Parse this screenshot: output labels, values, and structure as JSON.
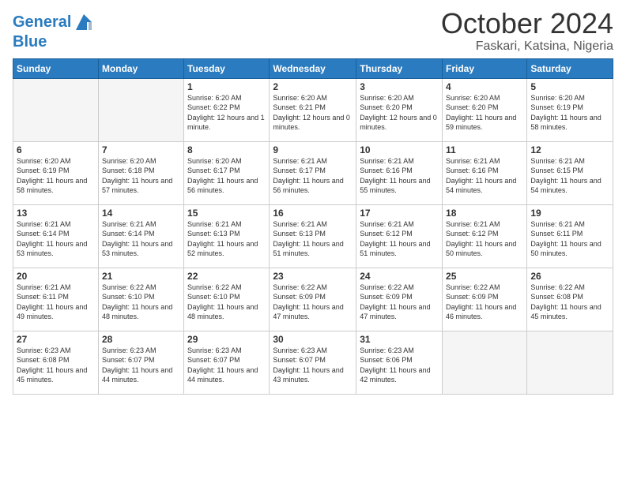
{
  "header": {
    "logo_line1": "General",
    "logo_line2": "Blue",
    "month": "October 2024",
    "location": "Faskari, Katsina, Nigeria"
  },
  "days_of_week": [
    "Sunday",
    "Monday",
    "Tuesday",
    "Wednesday",
    "Thursday",
    "Friday",
    "Saturday"
  ],
  "weeks": [
    [
      {
        "day": "",
        "info": ""
      },
      {
        "day": "",
        "info": ""
      },
      {
        "day": "1",
        "sunrise": "Sunrise: 6:20 AM",
        "sunset": "Sunset: 6:22 PM",
        "daylight": "Daylight: 12 hours and 1 minute."
      },
      {
        "day": "2",
        "sunrise": "Sunrise: 6:20 AM",
        "sunset": "Sunset: 6:21 PM",
        "daylight": "Daylight: 12 hours and 0 minutes."
      },
      {
        "day": "3",
        "sunrise": "Sunrise: 6:20 AM",
        "sunset": "Sunset: 6:20 PM",
        "daylight": "Daylight: 12 hours and 0 minutes."
      },
      {
        "day": "4",
        "sunrise": "Sunrise: 6:20 AM",
        "sunset": "Sunset: 6:20 PM",
        "daylight": "Daylight: 11 hours and 59 minutes."
      },
      {
        "day": "5",
        "sunrise": "Sunrise: 6:20 AM",
        "sunset": "Sunset: 6:19 PM",
        "daylight": "Daylight: 11 hours and 58 minutes."
      }
    ],
    [
      {
        "day": "6",
        "sunrise": "Sunrise: 6:20 AM",
        "sunset": "Sunset: 6:19 PM",
        "daylight": "Daylight: 11 hours and 58 minutes."
      },
      {
        "day": "7",
        "sunrise": "Sunrise: 6:20 AM",
        "sunset": "Sunset: 6:18 PM",
        "daylight": "Daylight: 11 hours and 57 minutes."
      },
      {
        "day": "8",
        "sunrise": "Sunrise: 6:20 AM",
        "sunset": "Sunset: 6:17 PM",
        "daylight": "Daylight: 11 hours and 56 minutes."
      },
      {
        "day": "9",
        "sunrise": "Sunrise: 6:21 AM",
        "sunset": "Sunset: 6:17 PM",
        "daylight": "Daylight: 11 hours and 56 minutes."
      },
      {
        "day": "10",
        "sunrise": "Sunrise: 6:21 AM",
        "sunset": "Sunset: 6:16 PM",
        "daylight": "Daylight: 11 hours and 55 minutes."
      },
      {
        "day": "11",
        "sunrise": "Sunrise: 6:21 AM",
        "sunset": "Sunset: 6:16 PM",
        "daylight": "Daylight: 11 hours and 54 minutes."
      },
      {
        "day": "12",
        "sunrise": "Sunrise: 6:21 AM",
        "sunset": "Sunset: 6:15 PM",
        "daylight": "Daylight: 11 hours and 54 minutes."
      }
    ],
    [
      {
        "day": "13",
        "sunrise": "Sunrise: 6:21 AM",
        "sunset": "Sunset: 6:14 PM",
        "daylight": "Daylight: 11 hours and 53 minutes."
      },
      {
        "day": "14",
        "sunrise": "Sunrise: 6:21 AM",
        "sunset": "Sunset: 6:14 PM",
        "daylight": "Daylight: 11 hours and 53 minutes."
      },
      {
        "day": "15",
        "sunrise": "Sunrise: 6:21 AM",
        "sunset": "Sunset: 6:13 PM",
        "daylight": "Daylight: 11 hours and 52 minutes."
      },
      {
        "day": "16",
        "sunrise": "Sunrise: 6:21 AM",
        "sunset": "Sunset: 6:13 PM",
        "daylight": "Daylight: 11 hours and 51 minutes."
      },
      {
        "day": "17",
        "sunrise": "Sunrise: 6:21 AM",
        "sunset": "Sunset: 6:12 PM",
        "daylight": "Daylight: 11 hours and 51 minutes."
      },
      {
        "day": "18",
        "sunrise": "Sunrise: 6:21 AM",
        "sunset": "Sunset: 6:12 PM",
        "daylight": "Daylight: 11 hours and 50 minutes."
      },
      {
        "day": "19",
        "sunrise": "Sunrise: 6:21 AM",
        "sunset": "Sunset: 6:11 PM",
        "daylight": "Daylight: 11 hours and 50 minutes."
      }
    ],
    [
      {
        "day": "20",
        "sunrise": "Sunrise: 6:21 AM",
        "sunset": "Sunset: 6:11 PM",
        "daylight": "Daylight: 11 hours and 49 minutes."
      },
      {
        "day": "21",
        "sunrise": "Sunrise: 6:22 AM",
        "sunset": "Sunset: 6:10 PM",
        "daylight": "Daylight: 11 hours and 48 minutes."
      },
      {
        "day": "22",
        "sunrise": "Sunrise: 6:22 AM",
        "sunset": "Sunset: 6:10 PM",
        "daylight": "Daylight: 11 hours and 48 minutes."
      },
      {
        "day": "23",
        "sunrise": "Sunrise: 6:22 AM",
        "sunset": "Sunset: 6:09 PM",
        "daylight": "Daylight: 11 hours and 47 minutes."
      },
      {
        "day": "24",
        "sunrise": "Sunrise: 6:22 AM",
        "sunset": "Sunset: 6:09 PM",
        "daylight": "Daylight: 11 hours and 47 minutes."
      },
      {
        "day": "25",
        "sunrise": "Sunrise: 6:22 AM",
        "sunset": "Sunset: 6:09 PM",
        "daylight": "Daylight: 11 hours and 46 minutes."
      },
      {
        "day": "26",
        "sunrise": "Sunrise: 6:22 AM",
        "sunset": "Sunset: 6:08 PM",
        "daylight": "Daylight: 11 hours and 45 minutes."
      }
    ],
    [
      {
        "day": "27",
        "sunrise": "Sunrise: 6:23 AM",
        "sunset": "Sunset: 6:08 PM",
        "daylight": "Daylight: 11 hours and 45 minutes."
      },
      {
        "day": "28",
        "sunrise": "Sunrise: 6:23 AM",
        "sunset": "Sunset: 6:07 PM",
        "daylight": "Daylight: 11 hours and 44 minutes."
      },
      {
        "day": "29",
        "sunrise": "Sunrise: 6:23 AM",
        "sunset": "Sunset: 6:07 PM",
        "daylight": "Daylight: 11 hours and 44 minutes."
      },
      {
        "day": "30",
        "sunrise": "Sunrise: 6:23 AM",
        "sunset": "Sunset: 6:07 PM",
        "daylight": "Daylight: 11 hours and 43 minutes."
      },
      {
        "day": "31",
        "sunrise": "Sunrise: 6:23 AM",
        "sunset": "Sunset: 6:06 PM",
        "daylight": "Daylight: 11 hours and 42 minutes."
      },
      {
        "day": "",
        "info": ""
      },
      {
        "day": "",
        "info": ""
      }
    ]
  ]
}
